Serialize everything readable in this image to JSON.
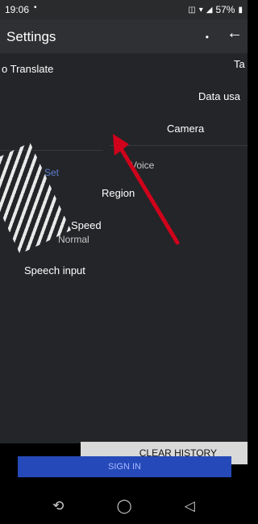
{
  "status": {
    "time": "19:06",
    "dot": "•",
    "battery": "57%",
    "icons": [
      "vibrate-icon",
      "wifi-icon",
      "signal-icon",
      "battery-icon"
    ]
  },
  "header": {
    "title": "Settings",
    "back_icon": "back-arrow-icon",
    "dot": "•"
  },
  "settings": {
    "tap_to_translate": "o Translate",
    "tap": "Ta",
    "data_usage": "Data usa",
    "camera": "Camera",
    "voice": "Voice",
    "region": "Region",
    "speed": "Speed",
    "speed_value": "Normal",
    "speech_input": "Speech input",
    "link_text": "Set"
  },
  "actions": {
    "clear_history": "CLEAR HISTORY",
    "blue_button": "SIGN IN"
  },
  "nav": {
    "back": "⟲",
    "home": "◯",
    "recents": "◁"
  },
  "colors": {
    "accent": "#2649b9",
    "arrow": "#d0021b",
    "background": "#242528"
  }
}
